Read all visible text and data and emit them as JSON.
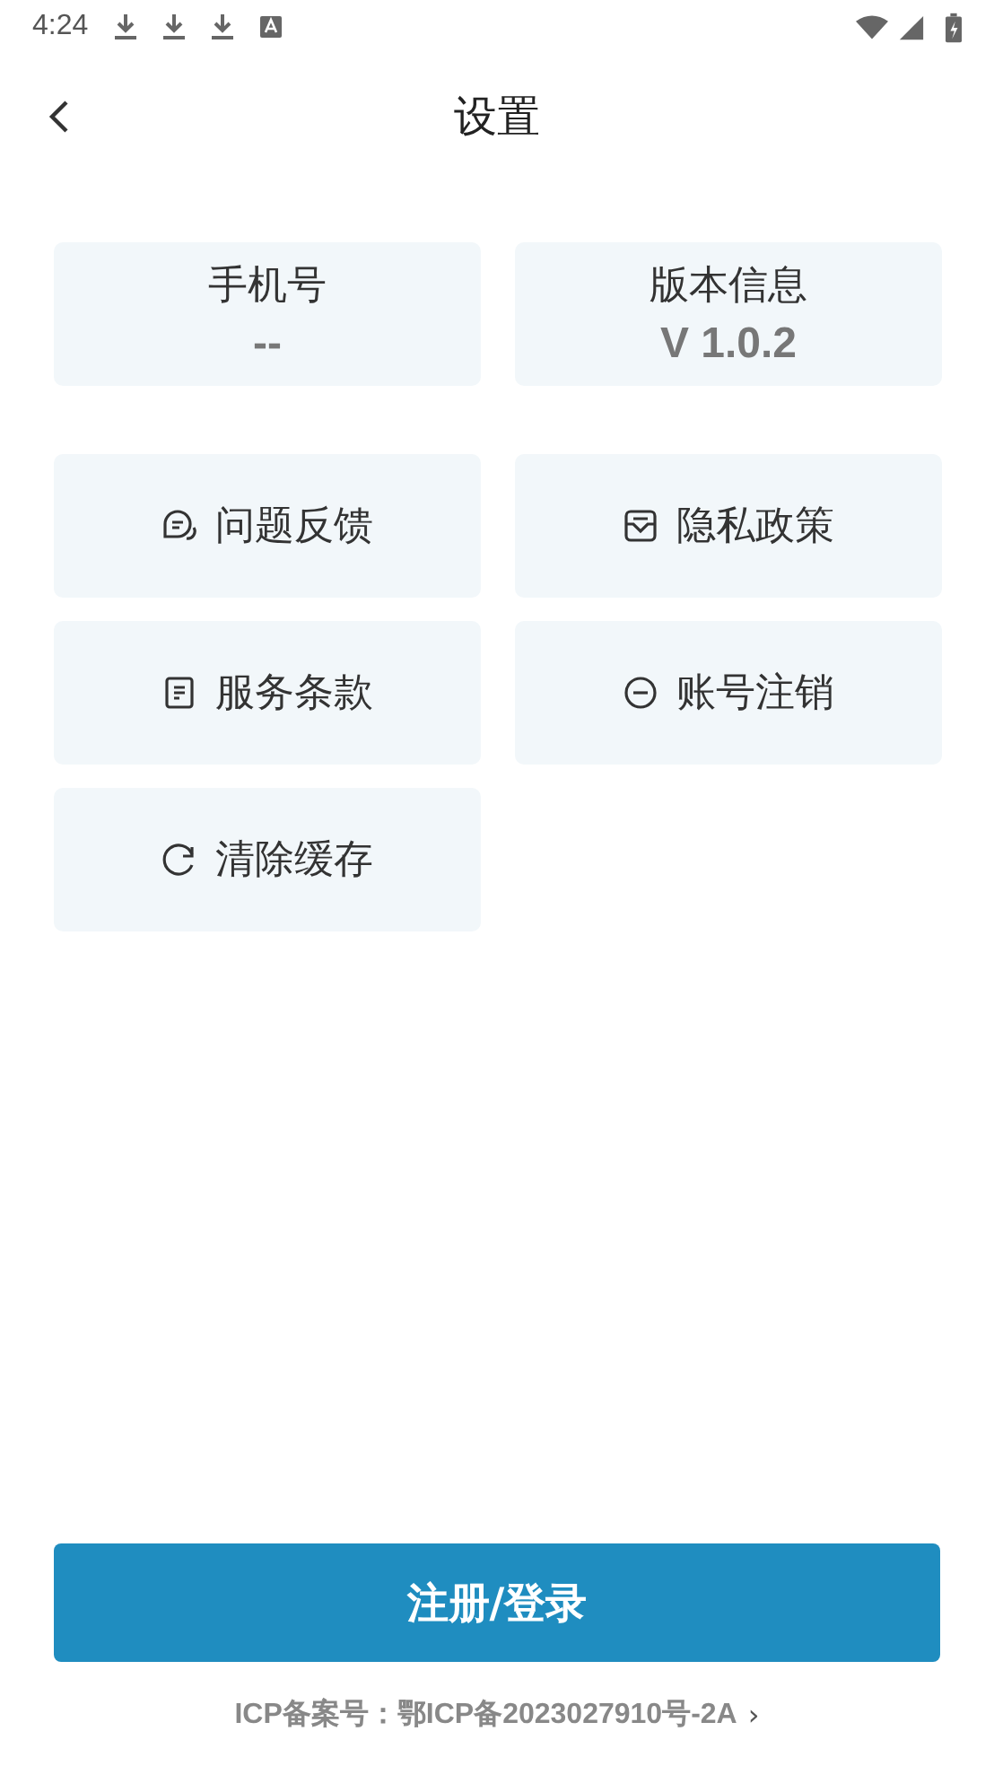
{
  "status_bar": {
    "time": "4:24",
    "notifications": [
      {
        "kind": "download"
      },
      {
        "kind": "download"
      },
      {
        "kind": "download"
      },
      {
        "kind": "keyboard"
      }
    ]
  },
  "header": {
    "title": "设置"
  },
  "info_cards": [
    {
      "label": "手机号",
      "value": "--"
    },
    {
      "label": "版本信息",
      "value": "V 1.0.2"
    }
  ],
  "menu": [
    {
      "label": "问题反馈",
      "kind": "chat"
    },
    {
      "label": "隐私政策",
      "kind": "inbox"
    },
    {
      "label": "服务条款",
      "kind": "document"
    },
    {
      "label": "账号注销",
      "kind": "minus"
    },
    {
      "label": "清除缓存",
      "kind": "refresh"
    }
  ],
  "login_button": "注册/登录",
  "footer": {
    "icp": "ICP备案号：鄂ICP备2023027910号-2A",
    "arrow": "›"
  }
}
